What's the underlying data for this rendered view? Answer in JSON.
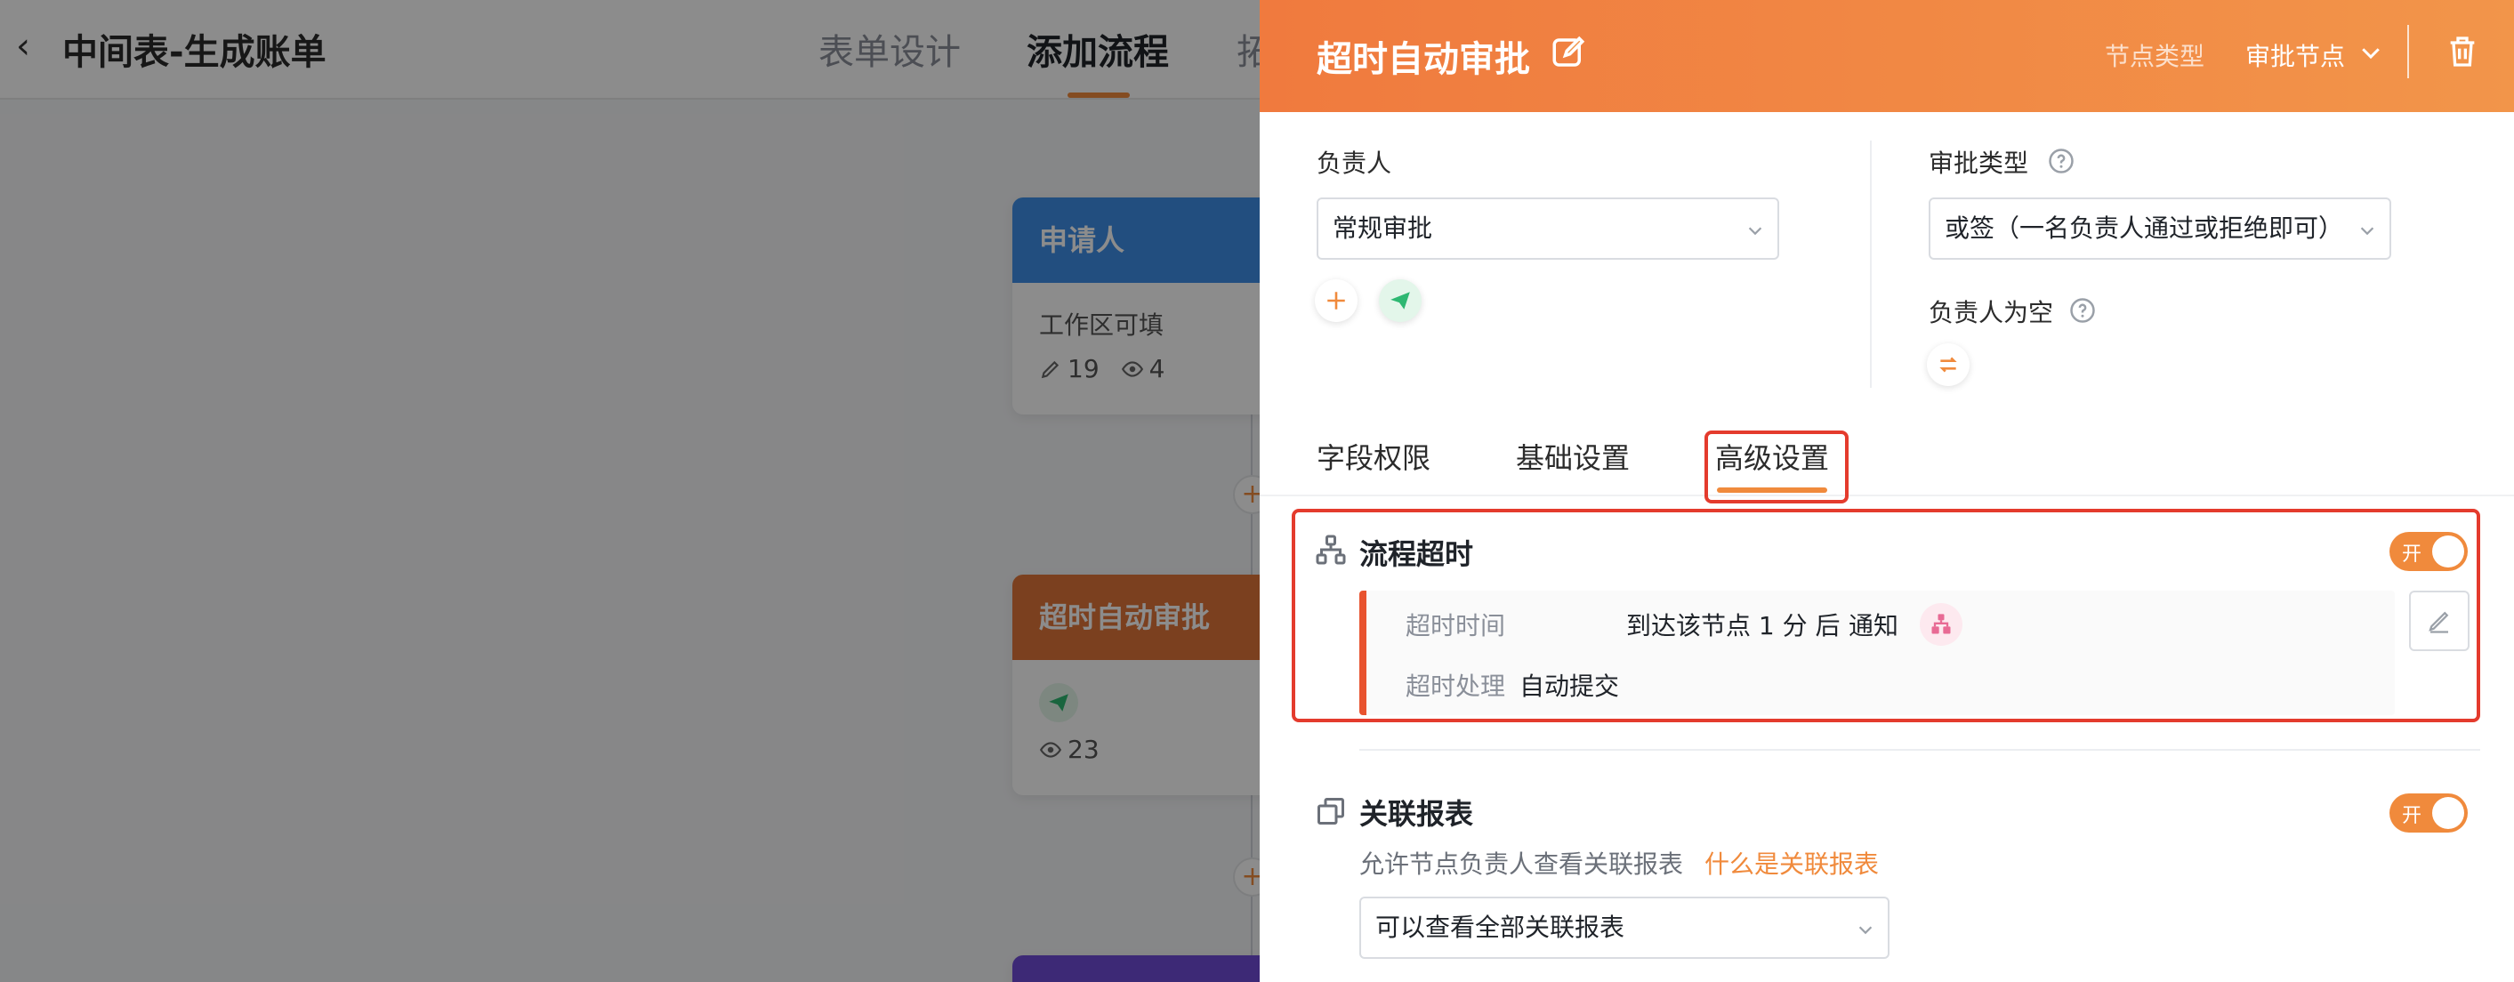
{
  "app": {
    "title": "中间表-生成账单",
    "tabs": [
      {
        "label": "表单设计"
      },
      {
        "label": "添加流程"
      },
      {
        "label": "拓"
      }
    ]
  },
  "flow": {
    "nodes": [
      {
        "title": "申请人",
        "subtitle": "工作区可填",
        "edit_count": "19",
        "view_count": "4"
      },
      {
        "title": "超时自动审批",
        "view_count": "23"
      }
    ]
  },
  "drawer": {
    "title": "超时自动审批",
    "node_type_label": "节点类型",
    "node_type_value": "审批节点",
    "owner": {
      "label": "负责人",
      "value": "常规审批"
    },
    "approval_type": {
      "label": "审批类型",
      "value": "或签（一名负责人通过或拒绝即可）"
    },
    "owner_empty": {
      "label": "负责人为空"
    },
    "tabs": [
      {
        "label": "字段权限"
      },
      {
        "label": "基础设置"
      },
      {
        "label": "高级设置"
      }
    ],
    "timeout": {
      "title": "流程超时",
      "toggle_label": "开",
      "time_label": "超时时间",
      "time_value": "到达该节点 1 分 后",
      "notify_label": "通知",
      "action_label": "超时处理",
      "action_value": "自动提交"
    },
    "related_report": {
      "title": "关联报表",
      "toggle_label": "开",
      "description": "允许节点负责人查看关联报表",
      "link": "什么是关联报表",
      "select_value": "可以查看全部关联报表"
    }
  },
  "colors": {
    "accent": "#f08a3c",
    "header_gradient_start": "#f07a3e",
    "highlight_red": "#e43b2d",
    "applicant_node": "#3f8fe8",
    "approval_node": "#e0763a",
    "purple_node": "#6f4bd8"
  }
}
